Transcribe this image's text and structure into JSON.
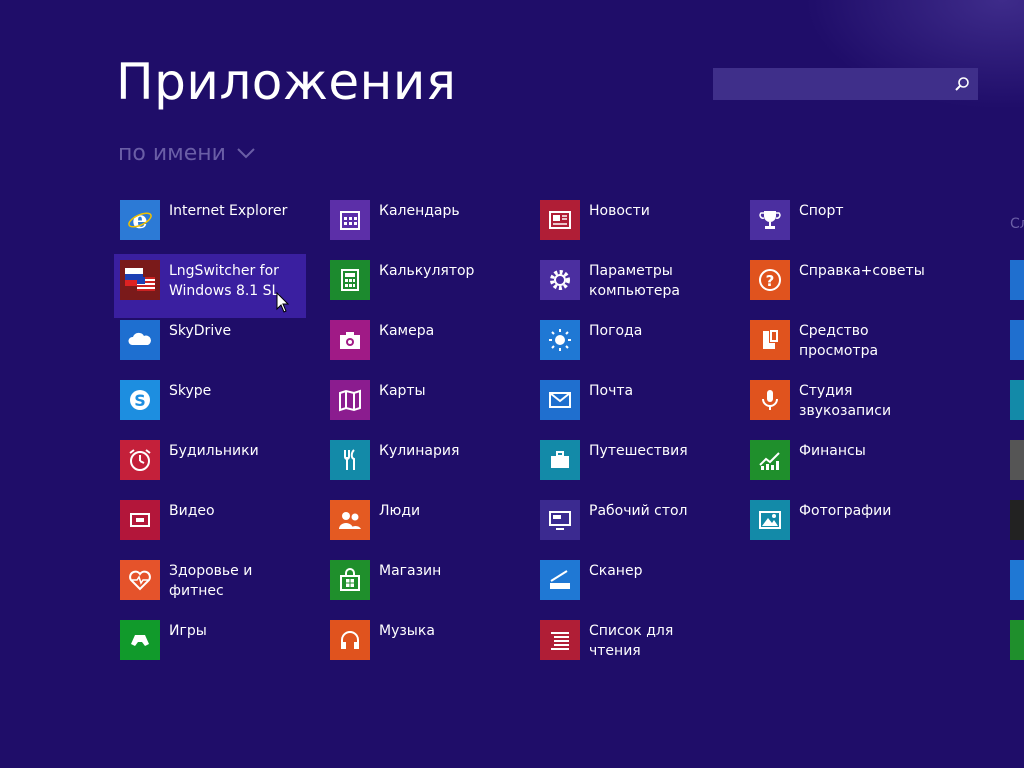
{
  "screen": {
    "title": "Приложения",
    "sort_label": "по имени",
    "search": {
      "placeholder": "",
      "value": ""
    },
    "edge_label": "Сл"
  },
  "columns": [
    [
      {
        "label": "Internet Explorer",
        "icon": "internet-explorer-icon",
        "color": "#2c7ad6",
        "name": "internet-explorer"
      },
      {
        "label": "LngSwitcher for\nWindows 8.1 SL",
        "icon": "flags-icon",
        "color": "#7a1a1a",
        "name": "lngswitcher",
        "selected": true
      },
      {
        "label": "SkyDrive",
        "icon": "cloud-icon",
        "color": "#1e6fd0",
        "name": "skydrive"
      },
      {
        "label": "Skype",
        "icon": "skype-icon",
        "color": "#1d8ee0",
        "name": "skype"
      },
      {
        "label": "Будильники",
        "icon": "alarm-clock-icon",
        "color": "#c4203a",
        "name": "alarms"
      },
      {
        "label": "Видео",
        "icon": "video-icon",
        "color": "#b3163a",
        "name": "video"
      },
      {
        "label": "Здоровье и\nфитнес",
        "icon": "heart-pulse-icon",
        "color": "#e5532b",
        "name": "health-fitness"
      },
      {
        "label": "Игры",
        "icon": "gamepad-icon",
        "color": "#119a2b",
        "name": "games"
      }
    ],
    [
      {
        "label": "Календарь",
        "icon": "calendar-icon",
        "color": "#5c2fa8",
        "name": "calendar"
      },
      {
        "label": "Калькулятор",
        "icon": "calculator-icon",
        "color": "#1c8a2e",
        "name": "calculator"
      },
      {
        "label": "Камера",
        "icon": "camera-icon",
        "color": "#a01a86",
        "name": "camera"
      },
      {
        "label": "Карты",
        "icon": "map-icon",
        "color": "#8b1c8f",
        "name": "maps"
      },
      {
        "label": "Кулинария",
        "icon": "fork-knife-icon",
        "color": "#138aa8",
        "name": "food-drink"
      },
      {
        "label": "Люди",
        "icon": "people-icon",
        "color": "#e45a22",
        "name": "people"
      },
      {
        "label": "Магазин",
        "icon": "store-icon",
        "color": "#1f8f2c",
        "name": "store"
      },
      {
        "label": "Музыка",
        "icon": "headphones-icon",
        "color": "#e0531e",
        "name": "music"
      }
    ],
    [
      {
        "label": "Новости",
        "icon": "news-icon",
        "color": "#b01e36",
        "name": "news"
      },
      {
        "label": "Параметры\nкомпьютера",
        "icon": "gear-icon",
        "color": "#4b2fa0",
        "name": "pc-settings"
      },
      {
        "label": "Погода",
        "icon": "sun-icon",
        "color": "#1f78d4",
        "name": "weather"
      },
      {
        "label": "Почта",
        "icon": "mail-icon",
        "color": "#1f6fcf",
        "name": "mail"
      },
      {
        "label": "Путешествия",
        "icon": "suitcase-icon",
        "color": "#138aa8",
        "name": "travel"
      },
      {
        "label": "Рабочий стол",
        "icon": "desktop-icon",
        "color": "#3b2a90",
        "name": "desktop"
      },
      {
        "label": "Сканер",
        "icon": "scanner-icon",
        "color": "#1f78d4",
        "name": "scanner"
      },
      {
        "label": "Список для чтения",
        "icon": "reading-list-icon",
        "color": "#b01e36",
        "name": "reading-list"
      }
    ],
    [
      {
        "label": "Спорт",
        "icon": "trophy-icon",
        "color": "#4b2fa0",
        "name": "sport"
      },
      {
        "label": "Справка+советы",
        "icon": "help-icon",
        "color": "#e0531e",
        "name": "help-tips"
      },
      {
        "label": "Средство\nпросмотра",
        "icon": "viewer-icon",
        "color": "#e0531e",
        "name": "reader"
      },
      {
        "label": "Студия\nзвукозаписи",
        "icon": "microphone-icon",
        "color": "#e0531e",
        "name": "sound-recorder"
      },
      {
        "label": "Финансы",
        "icon": "chart-icon",
        "color": "#1f8f2c",
        "name": "finance"
      },
      {
        "label": "Фотографии",
        "icon": "photo-icon",
        "color": "#138aa8",
        "name": "photos"
      }
    ]
  ],
  "edge_tile_colors": [
    "#1f6fcf",
    "#1f6fcf",
    "#138aa8",
    "#555555",
    "#222222",
    "#1f78d4",
    "#1f8f2c"
  ]
}
